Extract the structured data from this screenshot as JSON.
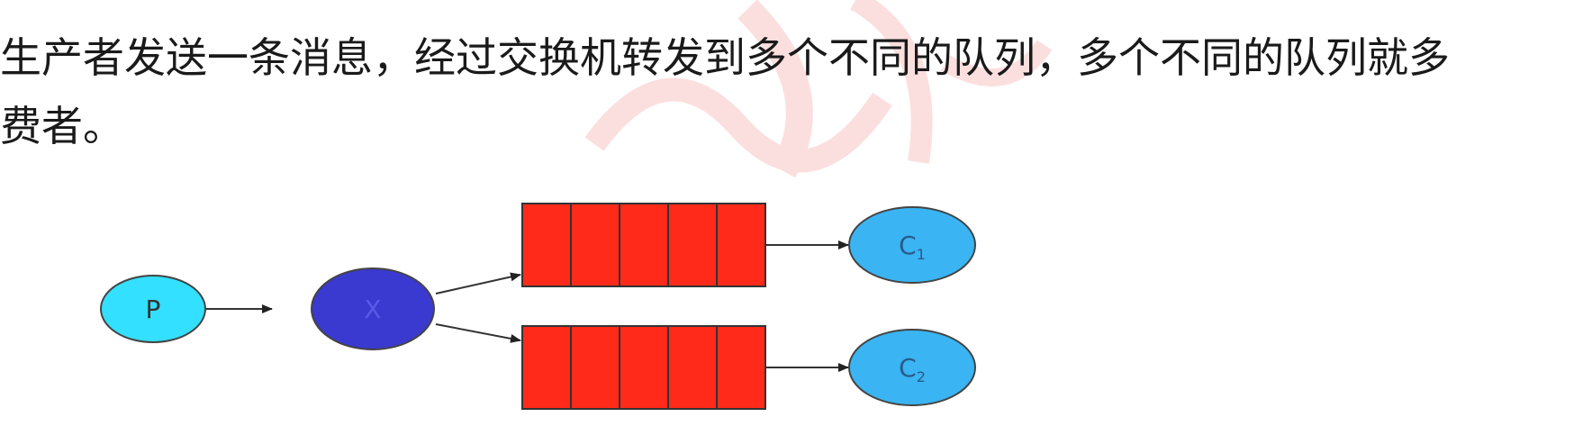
{
  "paragraph": {
    "line1": "生产者发送一条消息，经过交换机转发到多个不同的队列，多个不同的队列就多",
    "line2": "费者。"
  },
  "diagram": {
    "producer": {
      "label": "P",
      "fill": "#33e0ff"
    },
    "exchange": {
      "label": "X",
      "fill": "#3a3ad0"
    },
    "queues": [
      {
        "slots": 5,
        "fill": "#ff2a1a"
      },
      {
        "slots": 5,
        "fill": "#ff2a1a"
      }
    ],
    "consumers": [
      {
        "base": "C",
        "sub": "1",
        "fill": "#3ab4f2"
      },
      {
        "base": "C",
        "sub": "2",
        "fill": "#3ab4f2"
      }
    ]
  },
  "colors": {
    "text": "#1a1a1a",
    "arrow": "#333333",
    "watermark": "#e8403a"
  }
}
